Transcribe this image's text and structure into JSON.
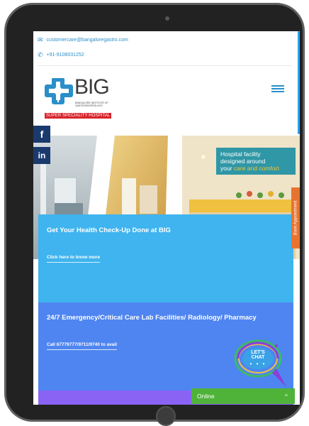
{
  "topbar": {
    "email": "customercare@bangaloregastro.com",
    "phone": "+91-9108031252",
    "email_icon": "envelope-icon",
    "phone_icon": "phone-icon"
  },
  "logo": {
    "name": "BIG",
    "subtitle": "BANGALORE INSTITUTE OF GASTROENTEROLOGY",
    "tagline": "SUPER SPECIALITY HOSPITAL"
  },
  "social": {
    "facebook": "f",
    "linkedin": "in"
  },
  "hero": {
    "caption_line1": "Hospital facility",
    "caption_line2": "designed around",
    "caption_line3a": "your ",
    "caption_line3b": "care and comfort"
  },
  "book_tab": "Book Appointment",
  "cards": [
    {
      "title": "Get Your Health Check-Up Done at BIG",
      "link": "Click here to know more"
    },
    {
      "title": "24/7 Emergency/Critical Care Lab Facilities/ Radiology/ Pharmacy",
      "link": "Call 67779777/9711/9740 to avail"
    }
  ],
  "chat": {
    "label": "LET'S CHAT",
    "dots": "• • •"
  },
  "online_bar": {
    "status": "Online",
    "toggle": "^"
  },
  "colors": {
    "brand_blue": "#2a8fc9",
    "brand_red": "#d8232a",
    "card_blue": "#3fb4ef",
    "card_purple": "#4f85f0",
    "card_violet": "#8a63f5",
    "online_green": "#4fb33a",
    "book_orange": "#e8732e",
    "social_navy": "#1a3a6e"
  }
}
